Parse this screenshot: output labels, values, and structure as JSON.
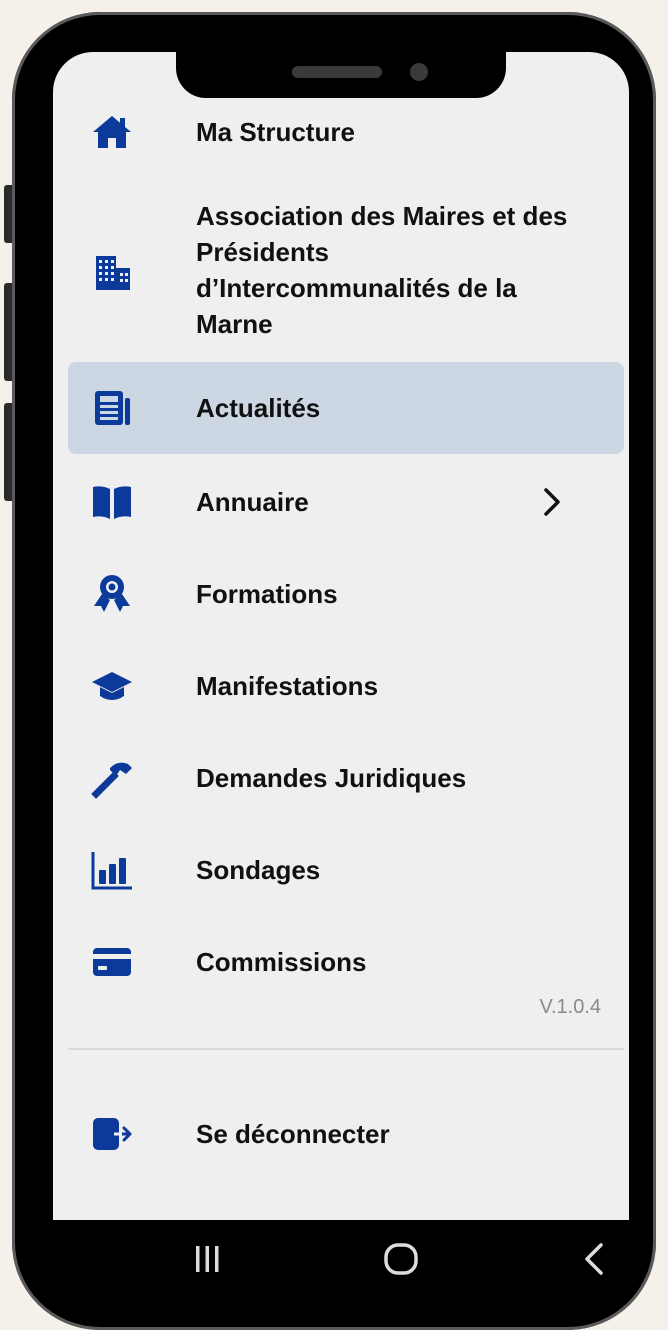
{
  "menu": {
    "items": [
      {
        "label": "Ma Structure",
        "icon": "home-icon"
      },
      {
        "label": "Association des Maires et des Présidents d’Intercommunalités de la Marne",
        "icon": "building-icon"
      },
      {
        "label": "Actualités",
        "icon": "newspaper-icon",
        "active": true
      },
      {
        "label": "Annuaire",
        "icon": "book-icon",
        "has_submenu": true
      },
      {
        "label": "Formations",
        "icon": "award-icon"
      },
      {
        "label": "Manifestations",
        "icon": "graduation-cap-icon"
      },
      {
        "label": "Demandes Juridiques",
        "icon": "hammer-icon"
      },
      {
        "label": "Sondages",
        "icon": "bar-chart-icon"
      },
      {
        "label": "Commissions",
        "icon": "card-icon"
      }
    ],
    "version": "V.1.0.4",
    "logout_label": "Se déconnecter"
  },
  "colors": {
    "accent": "#0b3a9a",
    "active_bg": "#cdd7e4",
    "screen_bg": "#efefef",
    "text": "#111111"
  }
}
